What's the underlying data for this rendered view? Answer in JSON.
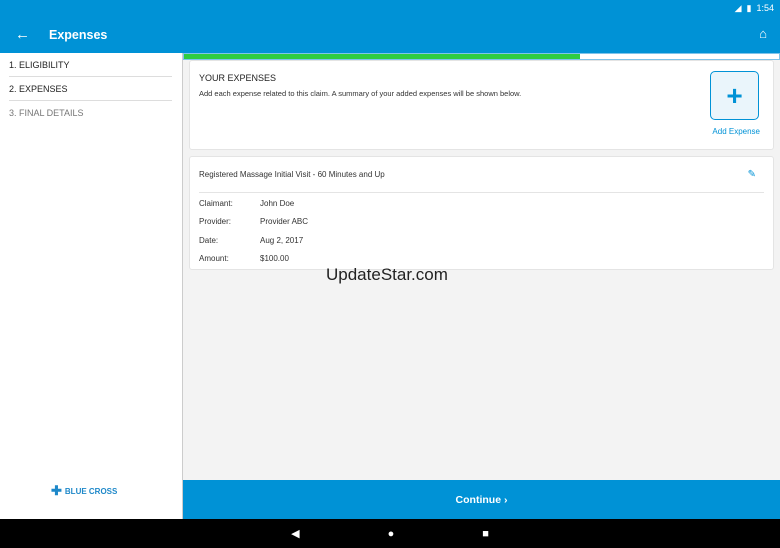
{
  "status": {
    "time": "1:54"
  },
  "appbar": {
    "title": "Expenses"
  },
  "sidebar": {
    "steps": [
      {
        "label": "1. ELIGIBILITY"
      },
      {
        "label": "2. EXPENSES"
      },
      {
        "label": "3. FINAL DETAILS"
      }
    ],
    "logo": "BLUE CROSS"
  },
  "progress": {
    "percent": 66.5
  },
  "summary": {
    "heading": "YOUR EXPENSES",
    "description": "Add each expense related to this claim. A summary of your added expenses will be shown below.",
    "add_label": "Add Expense"
  },
  "expense": {
    "title": "Registered Massage Initial Visit - 60 Minutes and Up",
    "fields": [
      {
        "label": "Claimant:",
        "value": "John Doe"
      },
      {
        "label": "Provider:",
        "value": "Provider ABC"
      },
      {
        "label": "Date:",
        "value": "Aug 2, 2017"
      },
      {
        "label": "Amount:",
        "value": "$100.00"
      }
    ]
  },
  "watermark": "UpdateStar.com",
  "continue_label": "Continue ›",
  "colors": {
    "primary": "#0092d6",
    "progress": "#2ecc40"
  }
}
